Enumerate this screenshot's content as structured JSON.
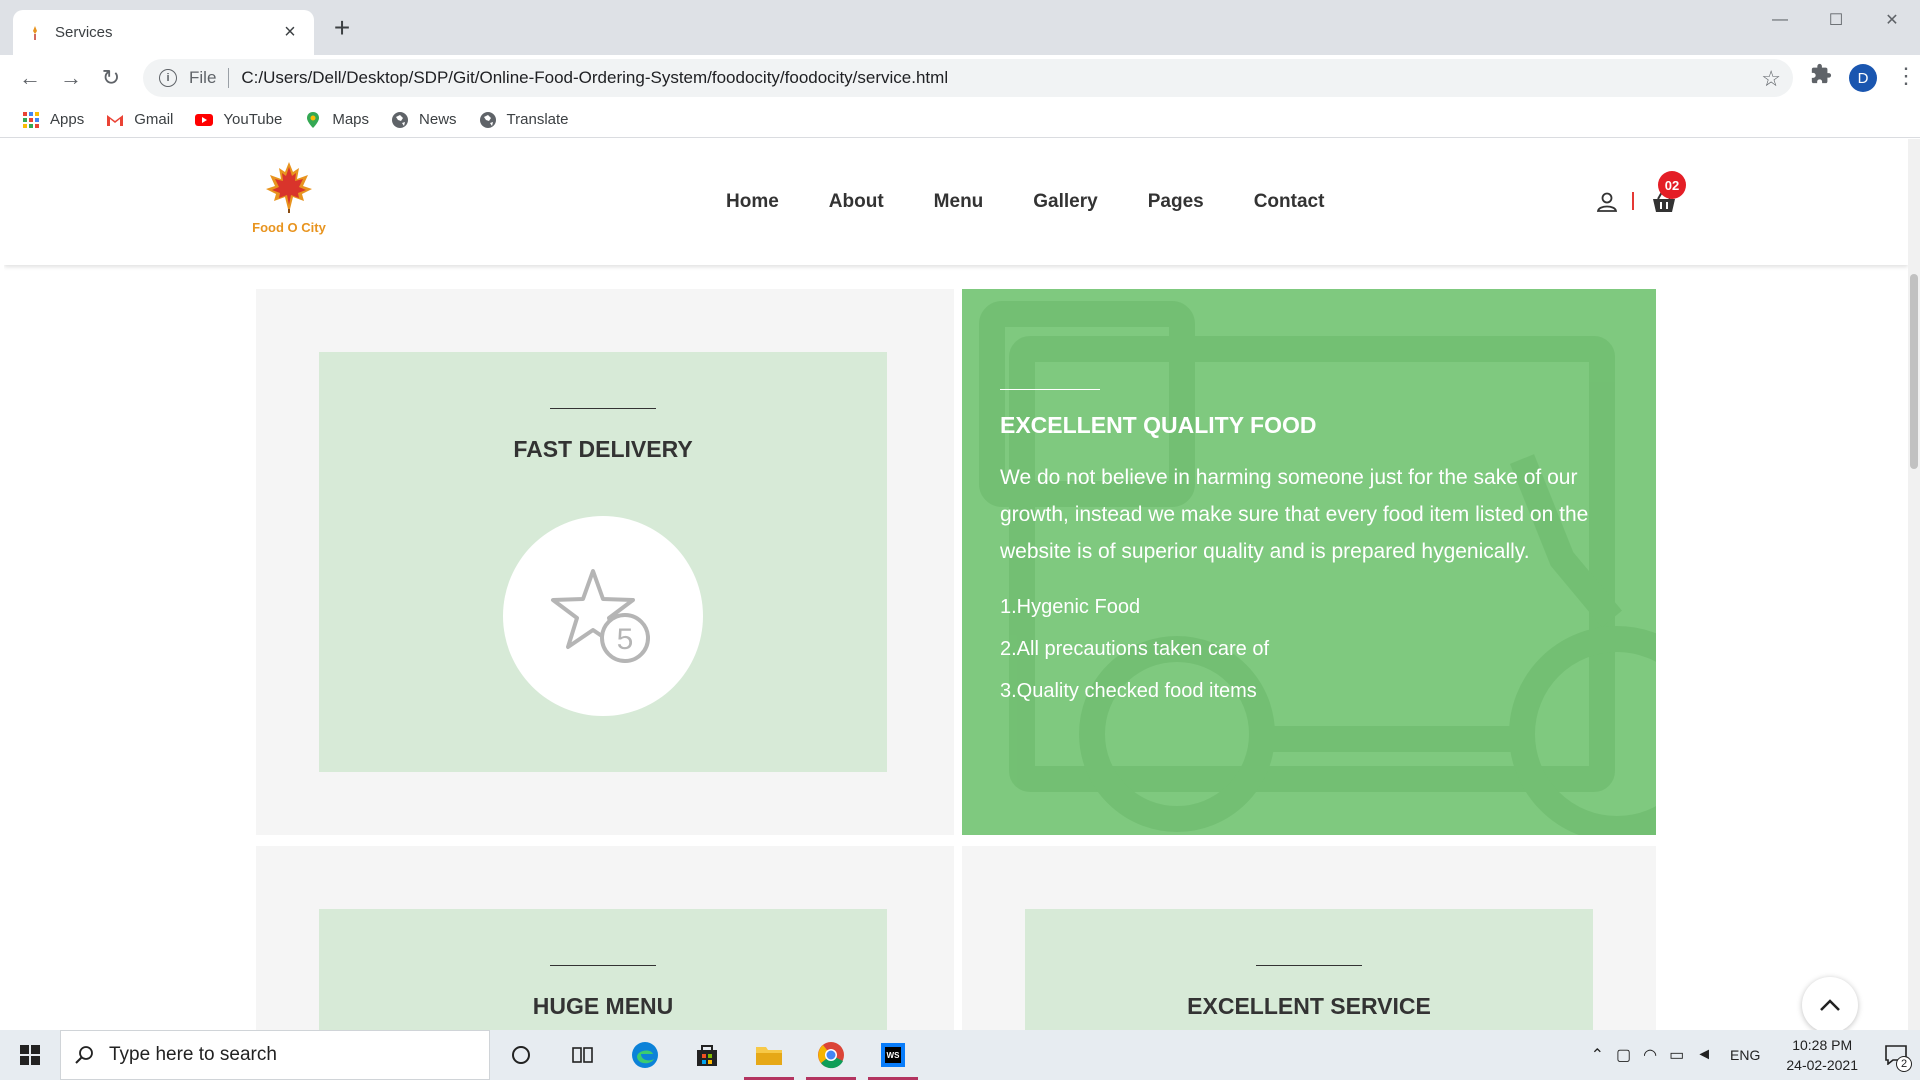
{
  "browser": {
    "tab_title": "Services",
    "new_tab_label": "+",
    "file_label": "File",
    "url": "C:/Users/Dell/Desktop/SDP/Git/Online-Food-Ordering-System/foodocity/foodocity/service.html",
    "profile_initial": "D",
    "bookmarks": [
      "Apps",
      "Gmail",
      "YouTube",
      "Maps",
      "News",
      "Translate"
    ]
  },
  "site": {
    "logo_text": "Food O City",
    "nav": [
      "Home",
      "About",
      "Menu",
      "Gallery",
      "Pages",
      "Contact"
    ],
    "cart_count": "02"
  },
  "cards": {
    "fast_delivery": {
      "title": "FAST DELIVERY",
      "icon": "five-star-rating-icon"
    },
    "excellent_quality": {
      "title": "EXCELLENT QUALITY FOOD",
      "description": "We do not believe in harming someone just for the sake of our growth, instead we make sure that every food item listed on the website is of superior quality and is prepared hygenically.",
      "items": [
        "1.Hygenic Food",
        "2.All precautions taken care of",
        "3.Quality checked food items"
      ]
    },
    "huge_menu": {
      "title": "HUGE MENU"
    },
    "excellent_service": {
      "title": "EXCELLENT SERVICE"
    }
  },
  "taskbar": {
    "search_placeholder": "Type here to search",
    "language": "ENG",
    "time": "10:28 PM",
    "date": "24-02-2021",
    "notification_count": "2"
  },
  "colors": {
    "brand_orange": "#e8941f",
    "card_green_light": "#d7ead7",
    "card_green_hover": "#7fc97f",
    "badge_red": "#e41e26"
  }
}
